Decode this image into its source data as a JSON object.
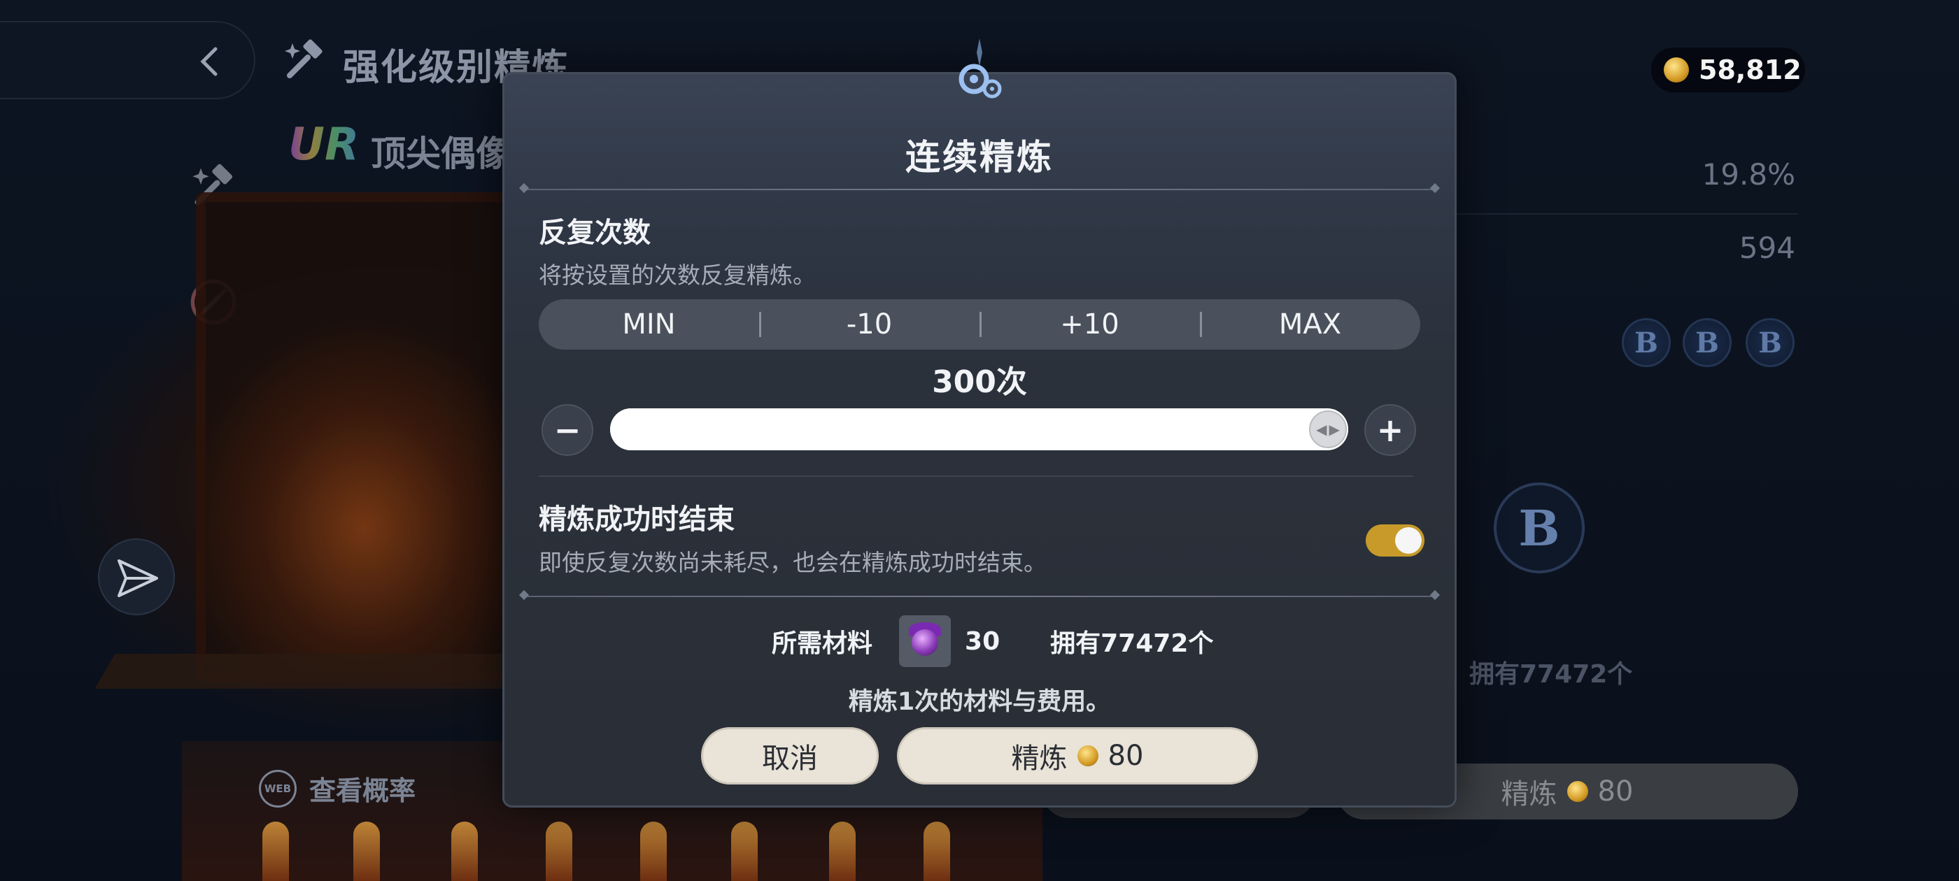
{
  "background": {
    "title": "强化级别精炼",
    "subtitle": "顶尖偶像",
    "ur_badge": "UR",
    "currency_amount": "58,812",
    "rate": "19.8%",
    "count": "594",
    "badge_letter": "B",
    "owned_text": "拥有77472个",
    "probability_link": "查看概率",
    "web_icon_text": "WEB",
    "refine_label": "精炼",
    "refine_cost": "80"
  },
  "modal": {
    "title": "连续精炼",
    "repeat": {
      "title": "反复次数",
      "description": "将按设置的次数反复精炼。",
      "steps": [
        "MIN",
        "-10",
        "+10",
        "MAX"
      ],
      "count_text": "300次",
      "slider_value_fraction": 1.0,
      "minus_symbol": "−",
      "plus_symbol": "+"
    },
    "stop_on_success": {
      "title": "精炼成功时结束",
      "description": "即使反复次数尚未耗尽，也会在精炼成功时结束。",
      "enabled": true
    },
    "materials": {
      "label": "所需材料",
      "amount": "30",
      "owned": "拥有77472个",
      "note": "精炼1次的材料与费用。"
    },
    "cancel_label": "取消",
    "confirm_label": "精炼",
    "confirm_cost": "80"
  },
  "colors": {
    "toggle_on": "#c79a2a",
    "button_bg": "#e9e3d8",
    "modal_bg": "#2b313b"
  }
}
